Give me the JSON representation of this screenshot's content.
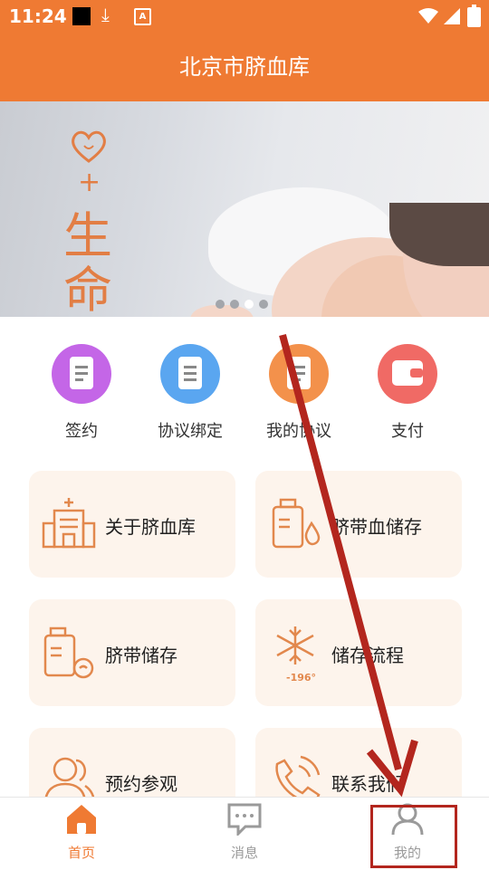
{
  "status_bar": {
    "time": "11:24",
    "icon_download": "download-icon",
    "badge_a": "A"
  },
  "header": {
    "title": "北京市脐血库"
  },
  "banner": {
    "logo_plus": "+",
    "logo_line1": "生",
    "logo_line2": "命",
    "dots": 4,
    "active_dot": 3
  },
  "quick_actions": [
    {
      "label": "签约",
      "icon": "clipboard-edit-icon",
      "color": "#c466e7"
    },
    {
      "label": "协议绑定",
      "icon": "document-icon",
      "color": "#5aa6f0"
    },
    {
      "label": "我的协议",
      "icon": "contract-icon",
      "color": "#f3914b"
    },
    {
      "label": "支付",
      "icon": "wallet-icon",
      "color": "#f06a65"
    }
  ],
  "cards": [
    {
      "label": "关于脐血库",
      "icon": "hospital-icon"
    },
    {
      "label": "脐带血储存",
      "icon": "storage-drop-icon"
    },
    {
      "label": "脐带储存",
      "icon": "storage-tank-icon"
    },
    {
      "label": "储存流程",
      "icon": "snowflake-icon",
      "icon_text": "-196°"
    },
    {
      "label": "预约参观",
      "icon": "people-icon"
    },
    {
      "label": "联系我们",
      "icon": "phone-icon"
    }
  ],
  "tabbar": [
    {
      "label": "首页",
      "icon": "home-icon",
      "active": true
    },
    {
      "label": "消息",
      "icon": "message-icon",
      "active": false
    },
    {
      "label": "我的",
      "icon": "user-icon",
      "active": false
    }
  ],
  "colors": {
    "brand": "#ef7a33",
    "card_bg": "#fdf4ec",
    "annotation": "#b3261e"
  }
}
